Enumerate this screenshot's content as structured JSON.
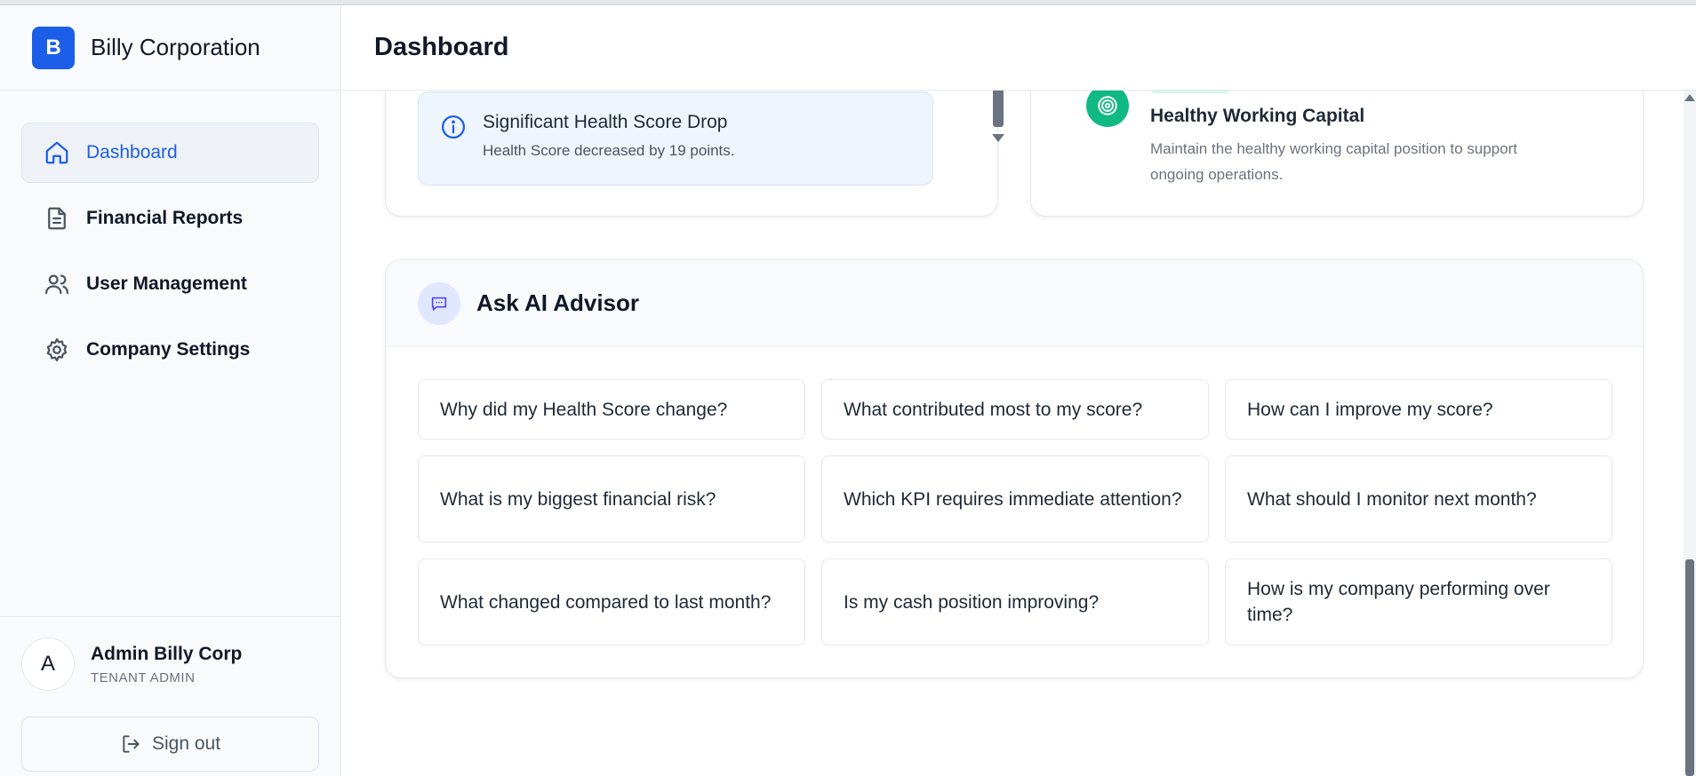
{
  "brand": {
    "initial": "B",
    "name": "Billy Corporation"
  },
  "header": {
    "title": "Dashboard"
  },
  "sidebar": {
    "items": [
      {
        "label": "Dashboard",
        "icon": "home-icon",
        "active": true
      },
      {
        "label": "Financial Reports",
        "icon": "document-icon"
      },
      {
        "label": "User Management",
        "icon": "users-icon"
      },
      {
        "label": "Company Settings",
        "icon": "gear-icon"
      }
    ]
  },
  "user": {
    "initial": "A",
    "name": "Admin Billy Corp",
    "role": "TENANT ADMIN"
  },
  "signout": {
    "label": "Sign out",
    "icon": "sign-out-icon"
  },
  "alert": {
    "icon": "info-icon",
    "title": "Significant Health Score Drop",
    "text": "Health Score decreased by 19 points."
  },
  "recommendation": {
    "icon": "target-icon",
    "title": "Healthy Working Capital",
    "text": "Maintain the healthy working capital position to support ongoing operations."
  },
  "advisor": {
    "icon": "chat-icon",
    "title": "Ask AI Advisor",
    "questions": [
      "Why did my Health Score change?",
      "What contributed most to my score?",
      "How can I improve my score?",
      "What is my biggest financial risk?",
      "Which KPI requires immediate attention?",
      "What should I monitor next month?",
      "What changed compared to last month?",
      "Is my cash position improving?",
      "How is my company performing over time?"
    ]
  },
  "colors": {
    "accent": "#1d5ee8",
    "success": "#10b981",
    "alert_bg": "#eef5fd",
    "advisor_icon_bg": "#e0e7ff"
  }
}
